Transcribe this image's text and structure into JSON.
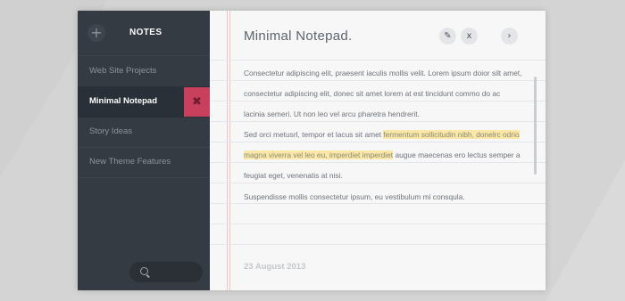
{
  "sidebar": {
    "title": "NOTES",
    "add_icon": "plus-icon",
    "add_glyph": "+",
    "items": [
      {
        "label": "Web Site Projects"
      },
      {
        "label": "Minimal Notepad",
        "active": true
      },
      {
        "label": "Story Ideas"
      },
      {
        "label": "New Theme Features"
      }
    ],
    "delete_icon": "close-icon",
    "delete_glyph": "✖",
    "search_icon": "search-icon"
  },
  "note": {
    "title": "Minimal Notepad.",
    "edit_icon": "pencil-icon",
    "edit_glyph": "✎",
    "close_icon": "close-icon",
    "close_glyph": "x",
    "next_icon": "chevron-right-icon",
    "next_glyph": "›",
    "paragraphs": [
      "Consectetur adipiscing elit, praesent iaculis mollis velit. Lorem ipsum doior silt amet, consectetur adipiscing elit, donec sit amet lorem at est tincidunt commo do ac lacinia semeri. Ut non leo vel arcu pharetra hendrerit.",
      {
        "before": "Sed orci metusrl, tempor et lacus sit amet ",
        "highlight": "fermentum sollicitudin nibh, donelrc odrio magna viverra vel leo eu, imperdiet imperdiet",
        "after": " augue maecenas ero lectus semper a feugiat eget, venenatis at nisi."
      },
      "Suspendisse mollis consectetur ipsum, eu vestibulum mi consqula."
    ],
    "date": "23 August 2013"
  },
  "colors": {
    "sidebar": "#353b43",
    "active_item": "#2a3037",
    "delete_accent": "#c8405e",
    "highlight": "#fbe8a6",
    "paper": "#f7f7f7",
    "margin_line": "#f0c4c4"
  }
}
